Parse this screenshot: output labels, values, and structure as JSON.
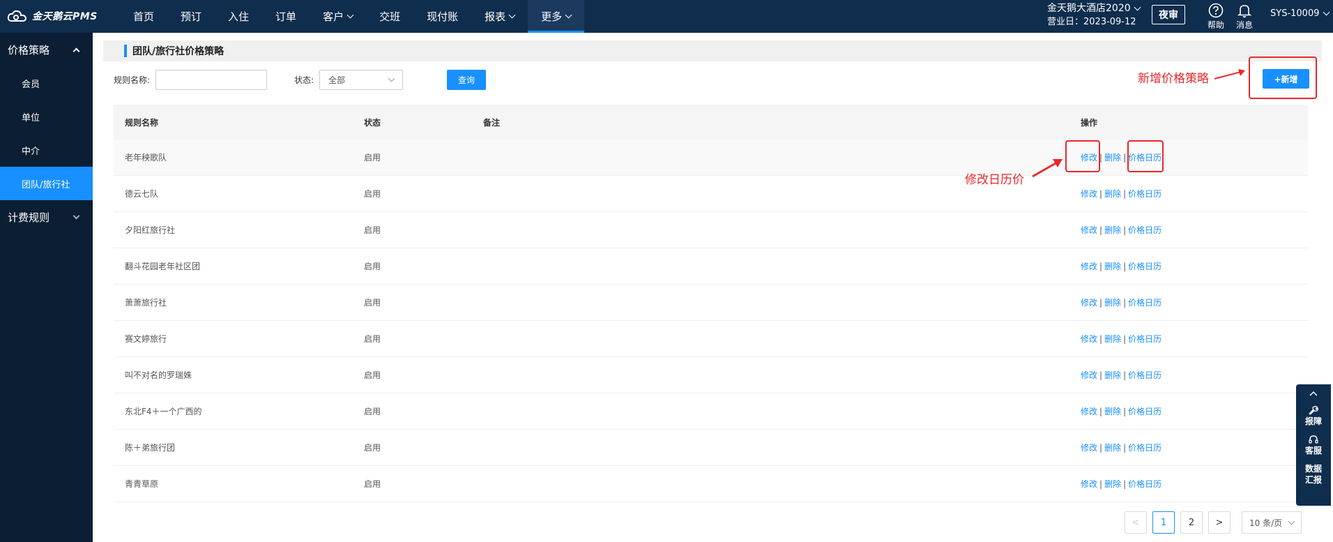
{
  "app": {
    "logo_text": "金天鹅云PMS"
  },
  "nav": {
    "items": [
      {
        "label": "首页",
        "dropdown": false
      },
      {
        "label": "预订",
        "dropdown": false
      },
      {
        "label": "入住",
        "dropdown": false
      },
      {
        "label": "订单",
        "dropdown": false
      },
      {
        "label": "客户",
        "dropdown": true
      },
      {
        "label": "交班",
        "dropdown": false
      },
      {
        "label": "现付账",
        "dropdown": false
      },
      {
        "label": "报表",
        "dropdown": true
      },
      {
        "label": "更多",
        "dropdown": true,
        "active": true
      }
    ]
  },
  "header": {
    "hotel_name": "金天鹅大酒店2020",
    "business_date": "营业日：2023-09-12",
    "night_audit": "夜审",
    "help": "帮助",
    "messages": "消息",
    "user": "SYS-10009"
  },
  "sidebar": {
    "group1": "价格策略",
    "items": [
      "会员",
      "单位",
      "中介",
      "团队/旅行社"
    ],
    "active_index": 3,
    "group2": "计费规则"
  },
  "page": {
    "title": "团队/旅行社价格策略",
    "rule_name_label": "规则名称:",
    "rule_name_value": "",
    "status_label": "状态:",
    "status_value": "全部",
    "query_button": "查询",
    "add_button": "+新增"
  },
  "table": {
    "headers": {
      "name": "规则名称",
      "status": "状态",
      "remark": "备注",
      "ops": "操作"
    },
    "ops": {
      "edit": "修改",
      "delete": "删除",
      "calendar": "价格日历",
      "sep": "|"
    },
    "rows": [
      {
        "name": "老年秧歌队",
        "status": "启用",
        "remark": ""
      },
      {
        "name": "德云七队",
        "status": "启用",
        "remark": ""
      },
      {
        "name": "夕阳红旅行社",
        "status": "启用",
        "remark": ""
      },
      {
        "name": "翻斗花园老年社区团",
        "status": "启用",
        "remark": ""
      },
      {
        "name": "萧萧旅行社",
        "status": "启用",
        "remark": ""
      },
      {
        "name": "赛文婷旅行",
        "status": "启用",
        "remark": ""
      },
      {
        "name": "叫不对名的罗瑞姝",
        "status": "启用",
        "remark": ""
      },
      {
        "name": "东北F4＋一个广西的",
        "status": "启用",
        "remark": ""
      },
      {
        "name": "陈＋弟旅行团",
        "status": "启用",
        "remark": ""
      },
      {
        "name": "青青草原",
        "status": "启用",
        "remark": ""
      }
    ]
  },
  "pagination": {
    "prev": "<",
    "pages": [
      "1",
      "2"
    ],
    "current": "1",
    "next": ">",
    "page_size": "10 条/页"
  },
  "annotations": {
    "add_strategy": "新增价格策略",
    "edit_calendar_price": "修改日历价"
  },
  "service_panel": {
    "report": "报障",
    "support": "客服",
    "data_report_line1": "数据",
    "data_report_line2": "汇报"
  },
  "colors": {
    "nav_bg": "#0f2d4d",
    "sidebar_bg": "#0b1e33",
    "primary": "#1890ff",
    "annotation": "#e8292a"
  }
}
